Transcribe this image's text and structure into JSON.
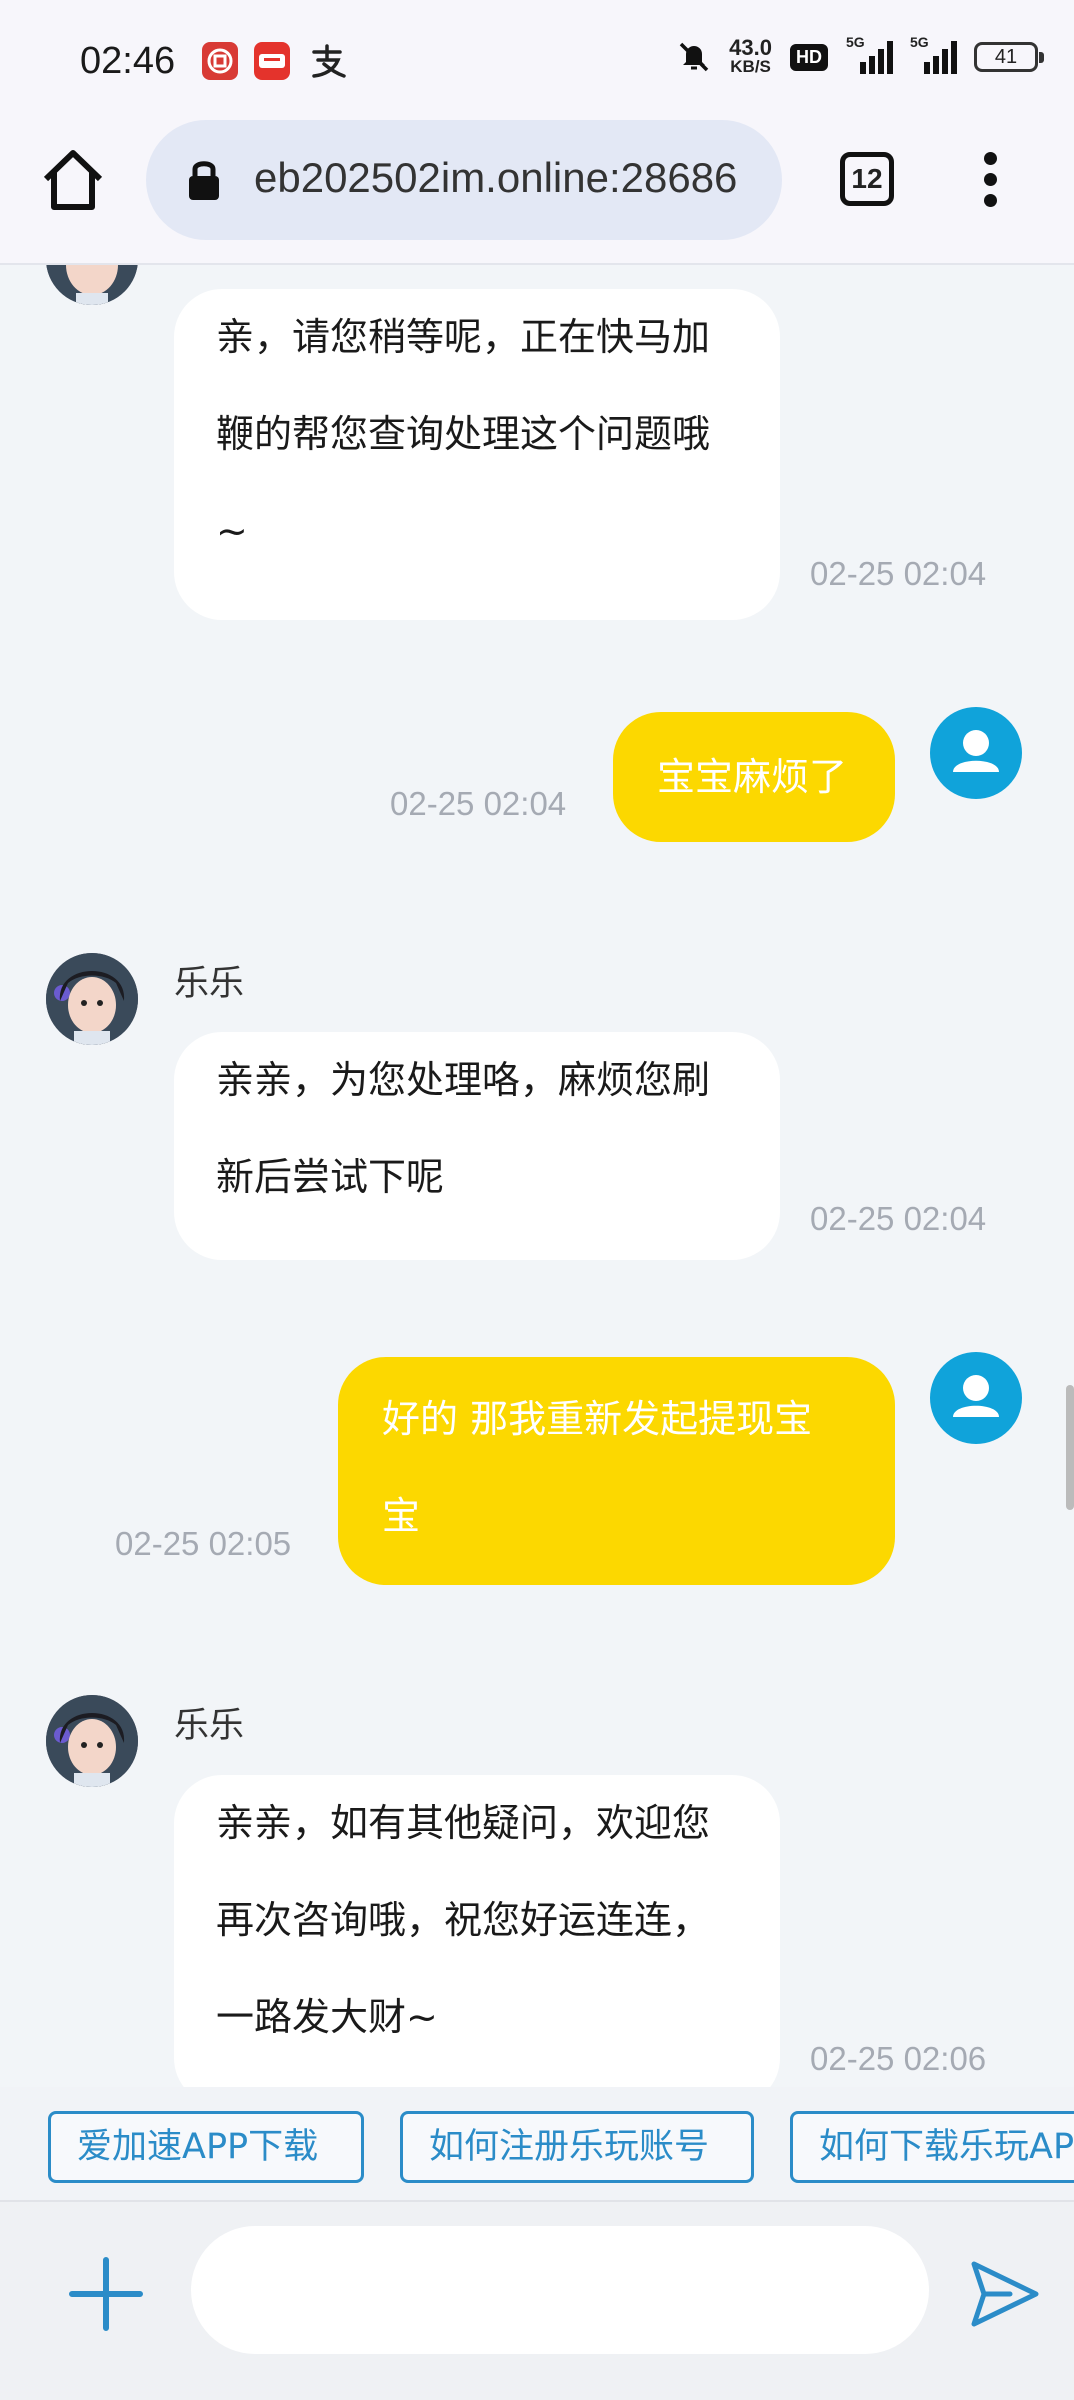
{
  "status_bar": {
    "time": "02:46",
    "net_speed_value": "43.0",
    "net_speed_unit": "KB/S",
    "hd_label": "HD",
    "signal_1": "5G",
    "signal_2": "5G",
    "battery": "41"
  },
  "browser": {
    "url": "eb202502im.online:28686",
    "tab_count": "12"
  },
  "messages": [
    {
      "from": "agent",
      "name": "",
      "lines": [
        "亲，请您稍等呢，正在快马加",
        "鞭的帮您查询处理这个问题哦",
        "~"
      ],
      "time": "02-25 02:04"
    },
    {
      "from": "user",
      "lines": [
        "宝宝麻烦了"
      ],
      "time": "02-25 02:04"
    },
    {
      "from": "agent",
      "name": "乐乐",
      "lines": [
        "亲亲，为您处理咯，麻烦您刷",
        "新后尝试下呢"
      ],
      "time": "02-25 02:04"
    },
    {
      "from": "user",
      "lines": [
        "好的 那我重新发起提现宝",
        "宝"
      ],
      "time": "02-25 02:05"
    },
    {
      "from": "agent",
      "name": "乐乐",
      "lines": [
        "亲亲，如有其他疑问，欢迎您",
        "再次咨询哦，祝您好运连连，",
        "一路发大财~"
      ],
      "time": "02-25 02:06"
    }
  ],
  "quick_links": [
    "爱加速APP下载",
    "如何注册乐玩账号",
    "如何下载乐玩APP"
  ],
  "composer": {
    "placeholder": ""
  },
  "colors": {
    "user_bubble": "#fcd800",
    "link_blue": "#2b8cc8",
    "user_avatar": "#10a3da"
  }
}
